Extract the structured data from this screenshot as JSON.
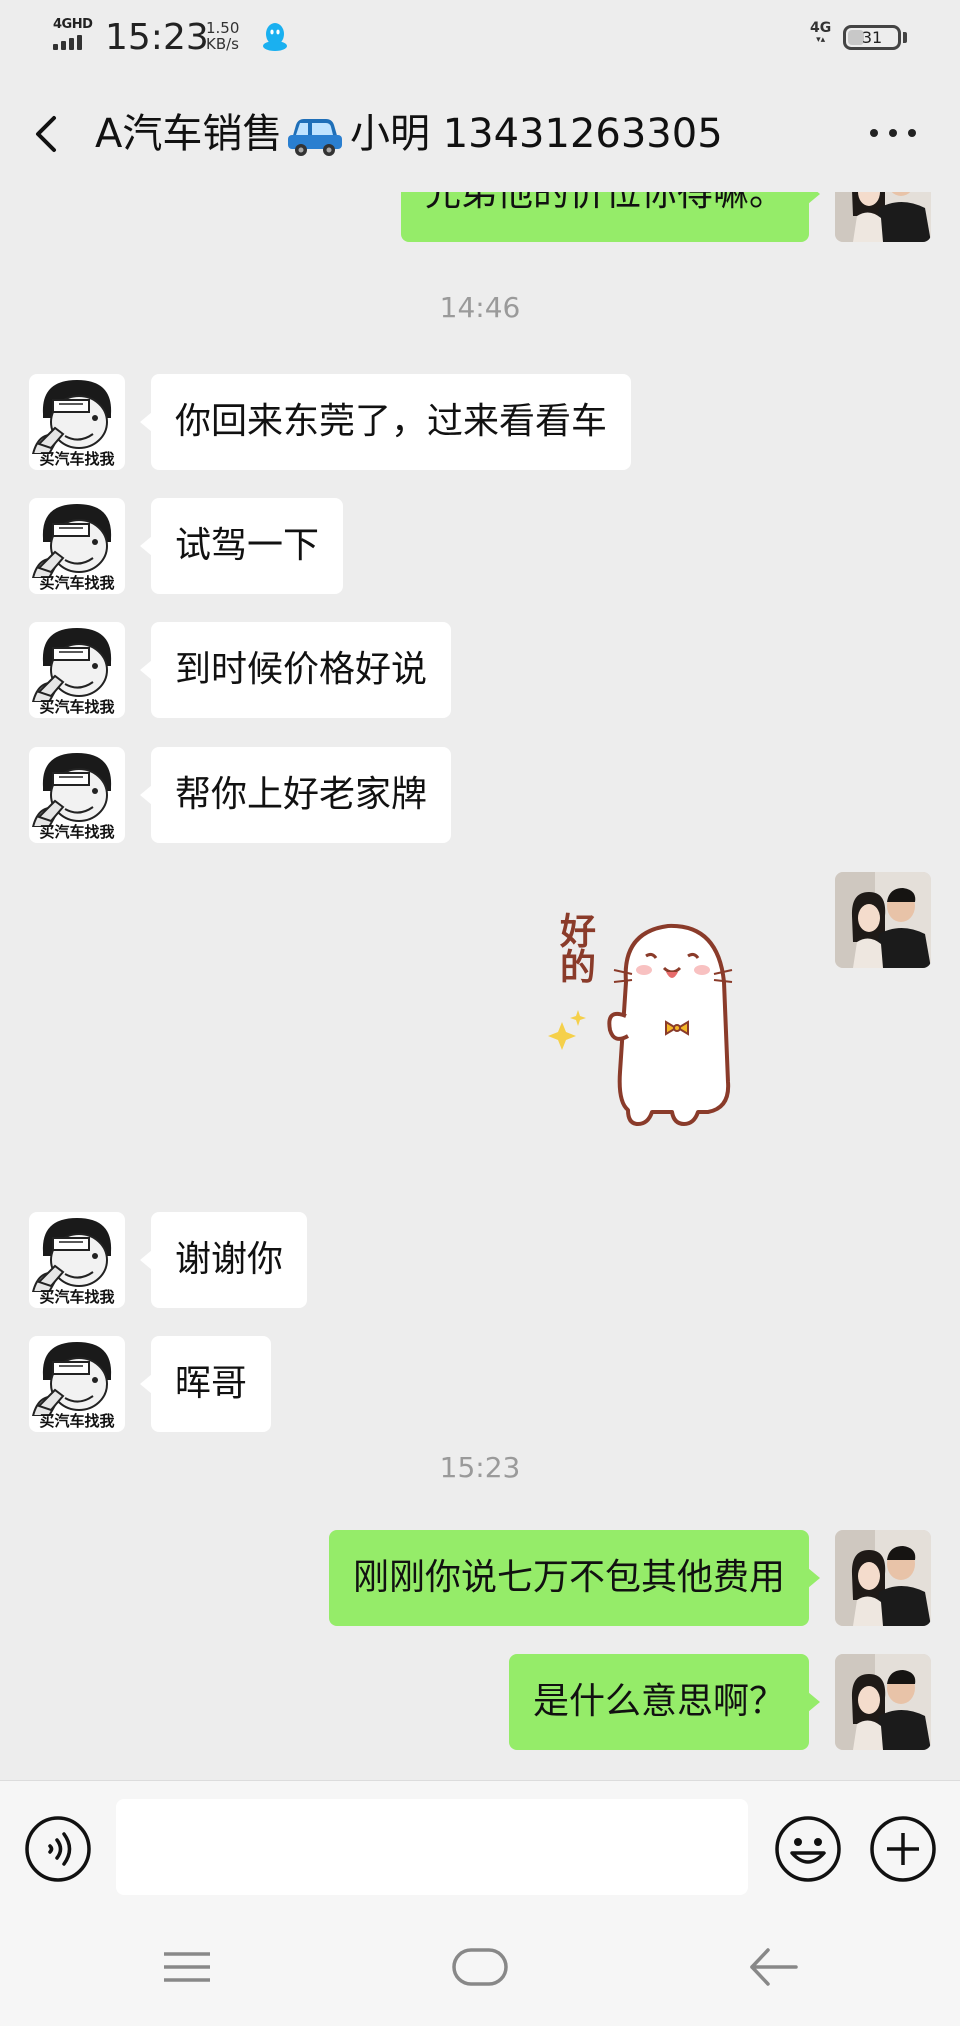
{
  "status_bar": {
    "network_label": "4GHD",
    "time": "15:23",
    "speed_value": "1.50",
    "speed_unit": "KB/s",
    "right_network": "4G",
    "battery": "31"
  },
  "header": {
    "title_prefix": "A汽车销售",
    "title_suffix": "小明 13431263305"
  },
  "messages": [
    {
      "type": "outgoing",
      "text": "兄弟他的价位你得嘛。"
    },
    {
      "type": "timestamp",
      "text": "14:46"
    },
    {
      "type": "incoming",
      "text": "你回来东莞了，过来看看车"
    },
    {
      "type": "incoming",
      "text": "试驾一下"
    },
    {
      "type": "incoming",
      "text": "到时候价格好说"
    },
    {
      "type": "incoming",
      "text": "帮你上好老家牌"
    },
    {
      "type": "outgoing_sticker",
      "text": "好的"
    },
    {
      "type": "incoming",
      "text": "谢谢你"
    },
    {
      "type": "incoming",
      "text": "晖哥"
    },
    {
      "type": "timestamp",
      "text": "15:23"
    },
    {
      "type": "outgoing",
      "text": "刚刚你说七万不包其他费用"
    },
    {
      "type": "outgoing",
      "text": "是什么意思啊？"
    }
  ],
  "contact_avatar_caption": "买汽车找我",
  "icons": {
    "back": "chevron-left-icon",
    "more": "more-dots-icon",
    "voice": "voice-icon",
    "emoji": "emoji-icon",
    "plus": "plus-icon"
  },
  "colors": {
    "background": "#ededed",
    "outgoing_bubble": "#95ec69",
    "incoming_bubble": "#ffffff"
  }
}
